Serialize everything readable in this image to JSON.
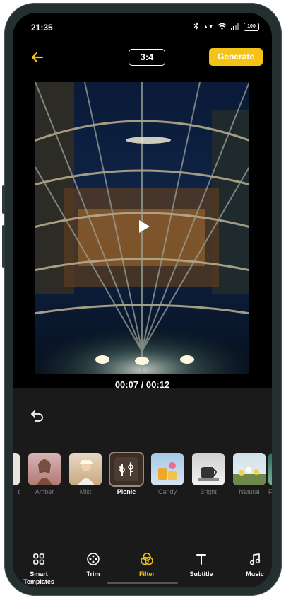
{
  "status": {
    "time": "21:35",
    "battery": "100"
  },
  "topbar": {
    "ratio": "3:4",
    "generate_label": "Generate"
  },
  "player": {
    "timecode": "00:07 / 00:12"
  },
  "filters": [
    {
      "label": "t"
    },
    {
      "label": "Amber"
    },
    {
      "label": "Mist"
    },
    {
      "label": "Picnic",
      "selected": true
    },
    {
      "label": "Candy"
    },
    {
      "label": "Bright"
    },
    {
      "label": "Natural"
    },
    {
      "label": "F"
    }
  ],
  "nav": [
    {
      "label": "Smart Templates",
      "icon": "grid-icon"
    },
    {
      "label": "Trim",
      "icon": "film-reel-icon"
    },
    {
      "label": "Filter",
      "icon": "filter-circles-icon",
      "active": true
    },
    {
      "label": "Subtitle",
      "icon": "text-t-icon"
    },
    {
      "label": "Music",
      "icon": "music-note-icon"
    }
  ],
  "colors": {
    "accent": "#f5c216",
    "panel": "#1a1a1a",
    "frame": "#23302f"
  }
}
